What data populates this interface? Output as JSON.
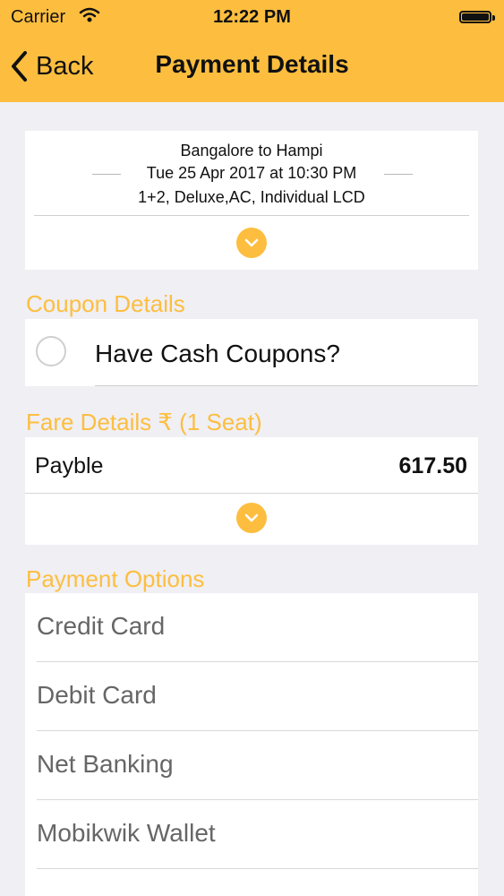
{
  "status_bar": {
    "carrier": "Carrier",
    "time": "12:22 PM",
    "wifi_icon": "wifi-icon",
    "battery_icon": "battery-icon"
  },
  "nav": {
    "back_label": "Back",
    "title": "Payment Details"
  },
  "journey": {
    "route": "Bangalore to Hampi",
    "datetime": "Tue 25 Apr 2017 at 10:30 PM",
    "bus_details": "1+2, Deluxe,AC, Individual LCD"
  },
  "sections": {
    "coupon_title": "Coupon Details",
    "fare_title": "Fare Details ₹ (1 Seat)",
    "payment_title": "Payment Options"
  },
  "coupon": {
    "label": "Have Cash Coupons?"
  },
  "fare": {
    "label": "Payble",
    "value": "617.50"
  },
  "payment_options": [
    {
      "label": "Credit Card"
    },
    {
      "label": "Debit Card"
    },
    {
      "label": "Net Banking"
    },
    {
      "label": "Mobikwik Wallet"
    }
  ],
  "colors": {
    "accent": "#fdbe3f",
    "background": "#efeff4"
  }
}
